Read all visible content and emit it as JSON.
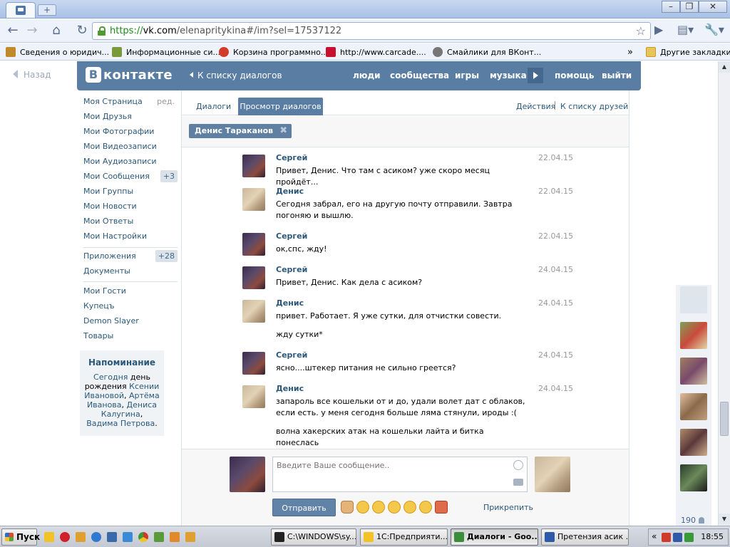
{
  "browser": {
    "url_scheme": "https://",
    "url_host": "vk.com",
    "url_rest": "/elenapritykina#/im?sel=17537122",
    "new_tab_label": "+",
    "win_minimize": "–",
    "win_restore": "❐",
    "win_close": "✕",
    "bookmarks": [
      {
        "label": "Сведения о юридич...",
        "color": "#c08a2a"
      },
      {
        "label": "Информационные си...",
        "color": "#7a9a3a"
      },
      {
        "label": "Корзина программно...",
        "color": "#d23a2a"
      },
      {
        "label": "http://www.carcade....",
        "color": "#c8102e"
      },
      {
        "label": "Смайлики для ВКонт...",
        "color": "#777777"
      }
    ],
    "bookmarks_more": "»",
    "other_bookmarks": "Другие закладки"
  },
  "vk": {
    "back": "Назад",
    "logo_letter": "В",
    "logo_text": "контакте",
    "to_dialogs_list": "К списку диалогов",
    "topnav": [
      "люди",
      "сообщества",
      "игры",
      "музыка",
      "помощь",
      "выйти"
    ],
    "left_menu": {
      "my_page": "Моя Страница",
      "edit": "ред.",
      "friends": "Мои Друзья",
      "photos": "Мои Фотографии",
      "videos": "Мои Видеозаписи",
      "audio": "Мои Аудиозаписи",
      "messages": "Мои Сообщения",
      "messages_badge": "+3",
      "groups": "Мои Группы",
      "news": "Мои Новости",
      "answers": "Мои Ответы",
      "settings": "Мои Настройки",
      "apps": "Приложения",
      "apps_badge": "+28",
      "docs": "Документы",
      "guests": "Мои Гости",
      "kupets": "Купецъ",
      "demon": "Demon Slayer",
      "goods": "Товары"
    },
    "reminder": {
      "title": "Напоминание",
      "today": "Сегодня",
      "birthday_text": " день рождения ",
      "p1": "Ксении Ивановой",
      "sep1": ", ",
      "p2": "Артёма Иванова",
      "sep2": ", ",
      "p3": "Дениса Калугина",
      "sep3": ", ",
      "p4": "Вадима Петрова",
      "end": "."
    },
    "tabs": {
      "dialogs": "Диалоги",
      "view_dialogs": "Просмотр диалогов",
      "actions": "Действия",
      "to_friends": "К списку друзей"
    },
    "peer_chip": "Денис Тараканов",
    "peer_chip_close": "✖",
    "messages": [
      {
        "author": "Сергей",
        "date": "22.04.15",
        "text": "Привет, Денис. Что там с асиком? уже скоро месяц пройдёт...",
        "text2": ""
      },
      {
        "author": "Денис",
        "date": "22.04.15",
        "text": "Сегодня забрал, его на другую почту отправили. Завтра погоняю и вышлю.",
        "text2": ""
      },
      {
        "author": "Сергей",
        "date": "22.04.15",
        "text": "ок,спс, жду!",
        "text2": ""
      },
      {
        "author": "Сергей",
        "date": "24.04.15",
        "text": "Привет, Денис. Как дела с асиком?",
        "text2": ""
      },
      {
        "author": "Денис",
        "date": "24.04.15",
        "text": "привет. Работает. Я уже сутки, для отчистки совести.",
        "text2": "жду сутки*"
      },
      {
        "author": "Сергей",
        "date": "24.04.15",
        "text": "ясно....штекер питания не сильно греется?",
        "text2": ""
      },
      {
        "author": "Денис",
        "date": "24.04.15",
        "text": "запароль все кошельки от и до, удали волет дат с облаков, если есть. у меня сегодня больше ляма стянули, ироды :(",
        "text2": "волна хакерских атак на кошельки лайта и битка понеслась"
      }
    ],
    "composer": {
      "placeholder": "Введите Ваше сообщение..",
      "send": "Отправить",
      "attach": "Прикрепить"
    },
    "side_count": "190"
  },
  "taskbar": {
    "start": "Пуск",
    "tasks": [
      {
        "label": "C:\\WINDOWS\\sy...",
        "color": "#222222",
        "active": false
      },
      {
        "label": "1С:Предприяти...",
        "color": "#f2c227",
        "active": false
      },
      {
        "label": "Диалоги - Goo...",
        "color": "#3a8e3a",
        "active": true
      },
      {
        "label": "Претензия асик ...",
        "color": "#2f5aa8",
        "active": false
      }
    ],
    "tray_more": "«",
    "clock": "18:55"
  }
}
